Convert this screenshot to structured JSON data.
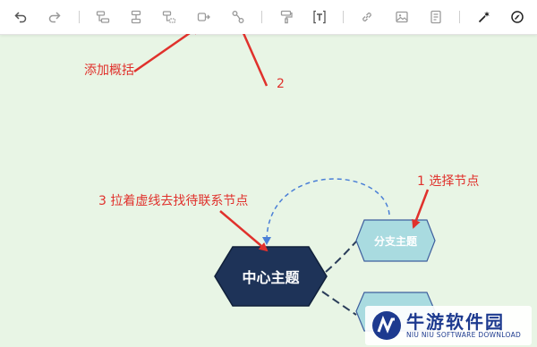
{
  "toolbar": {
    "buttons": [
      {
        "name": "undo-icon"
      },
      {
        "name": "redo-icon"
      },
      {
        "name": "add-sibling-node-icon"
      },
      {
        "name": "add-child-node-icon"
      },
      {
        "name": "add-parent-node-icon"
      },
      {
        "name": "add-summary-icon"
      },
      {
        "name": "add-relation-line-icon"
      },
      {
        "name": "format-painter-icon"
      },
      {
        "name": "insert-text-icon"
      },
      {
        "name": "insert-link-icon"
      },
      {
        "name": "insert-image-icon"
      },
      {
        "name": "insert-note-icon"
      },
      {
        "name": "magic-wand-icon"
      },
      {
        "name": "compass-icon"
      }
    ]
  },
  "annotations": {
    "add_summary": "添加概括",
    "step2": "2",
    "step1": "1 选择节点",
    "step3": "3 拉着虚线去找待联系节点"
  },
  "mindmap": {
    "central_topic": "中心主题",
    "branch_topic": "分支主题"
  },
  "watermark": {
    "title": "牛游软件园",
    "subtitle": "NIU NIU SOFTWARE DOWNLOAD"
  },
  "colors": {
    "canvas_bg": "#e8f5e5",
    "central_node": "#1e3358",
    "branch_node": "#a9dbe0",
    "annotation_red": "#e0312c",
    "relation_line": "#4a7fd6"
  }
}
